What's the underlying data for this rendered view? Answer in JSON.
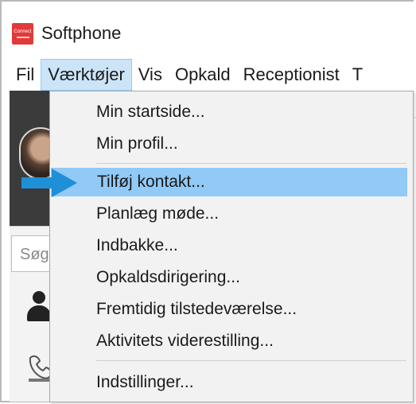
{
  "window": {
    "title": "Softphone",
    "logo_text": "Connect"
  },
  "menubar": {
    "items": [
      "Fil",
      "Værktøjer",
      "Vis",
      "Opkald",
      "Receptionist",
      "T"
    ],
    "active": "Værktøjer"
  },
  "background": {
    "search_placeholder": "Søg"
  },
  "dropdown": {
    "items": [
      "Min startside...",
      "Min profil...",
      "Tilføj kontakt...",
      "Planlæg møde...",
      "Indbakke...",
      "Opkaldsdirigering...",
      "Fremtidig tilstedeværelse...",
      "Aktivitets viderestilling...",
      "Indstillinger..."
    ],
    "highlighted": "Tilføj kontakt..."
  },
  "colors": {
    "highlight": "#91c9f7",
    "arrow": "#1f8fd8",
    "logo": "#e03a3a"
  }
}
